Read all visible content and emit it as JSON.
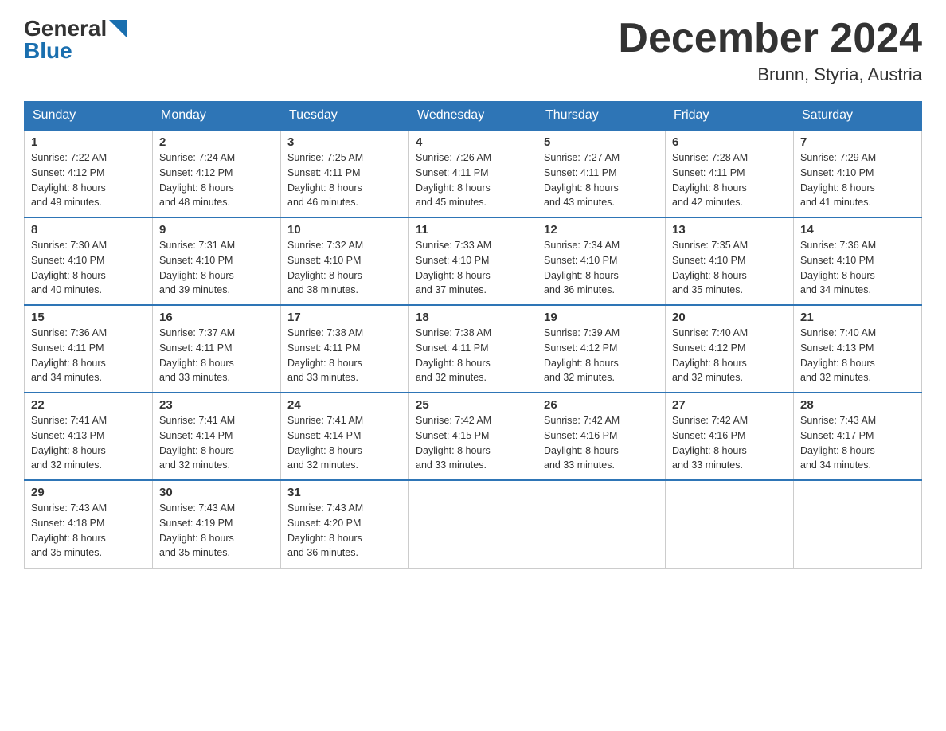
{
  "header": {
    "logo_general": "General",
    "logo_blue": "Blue",
    "title": "December 2024",
    "subtitle": "Brunn, Styria, Austria"
  },
  "days_of_week": [
    "Sunday",
    "Monday",
    "Tuesday",
    "Wednesday",
    "Thursday",
    "Friday",
    "Saturday"
  ],
  "weeks": [
    [
      {
        "day": "1",
        "sunrise": "7:22 AM",
        "sunset": "4:12 PM",
        "daylight": "8 hours and 49 minutes."
      },
      {
        "day": "2",
        "sunrise": "7:24 AM",
        "sunset": "4:12 PM",
        "daylight": "8 hours and 48 minutes."
      },
      {
        "day": "3",
        "sunrise": "7:25 AM",
        "sunset": "4:11 PM",
        "daylight": "8 hours and 46 minutes."
      },
      {
        "day": "4",
        "sunrise": "7:26 AM",
        "sunset": "4:11 PM",
        "daylight": "8 hours and 45 minutes."
      },
      {
        "day": "5",
        "sunrise": "7:27 AM",
        "sunset": "4:11 PM",
        "daylight": "8 hours and 43 minutes."
      },
      {
        "day": "6",
        "sunrise": "7:28 AM",
        "sunset": "4:11 PM",
        "daylight": "8 hours and 42 minutes."
      },
      {
        "day": "7",
        "sunrise": "7:29 AM",
        "sunset": "4:10 PM",
        "daylight": "8 hours and 41 minutes."
      }
    ],
    [
      {
        "day": "8",
        "sunrise": "7:30 AM",
        "sunset": "4:10 PM",
        "daylight": "8 hours and 40 minutes."
      },
      {
        "day": "9",
        "sunrise": "7:31 AM",
        "sunset": "4:10 PM",
        "daylight": "8 hours and 39 minutes."
      },
      {
        "day": "10",
        "sunrise": "7:32 AM",
        "sunset": "4:10 PM",
        "daylight": "8 hours and 38 minutes."
      },
      {
        "day": "11",
        "sunrise": "7:33 AM",
        "sunset": "4:10 PM",
        "daylight": "8 hours and 37 minutes."
      },
      {
        "day": "12",
        "sunrise": "7:34 AM",
        "sunset": "4:10 PM",
        "daylight": "8 hours and 36 minutes."
      },
      {
        "day": "13",
        "sunrise": "7:35 AM",
        "sunset": "4:10 PM",
        "daylight": "8 hours and 35 minutes."
      },
      {
        "day": "14",
        "sunrise": "7:36 AM",
        "sunset": "4:10 PM",
        "daylight": "8 hours and 34 minutes."
      }
    ],
    [
      {
        "day": "15",
        "sunrise": "7:36 AM",
        "sunset": "4:11 PM",
        "daylight": "8 hours and 34 minutes."
      },
      {
        "day": "16",
        "sunrise": "7:37 AM",
        "sunset": "4:11 PM",
        "daylight": "8 hours and 33 minutes."
      },
      {
        "day": "17",
        "sunrise": "7:38 AM",
        "sunset": "4:11 PM",
        "daylight": "8 hours and 33 minutes."
      },
      {
        "day": "18",
        "sunrise": "7:38 AM",
        "sunset": "4:11 PM",
        "daylight": "8 hours and 32 minutes."
      },
      {
        "day": "19",
        "sunrise": "7:39 AM",
        "sunset": "4:12 PM",
        "daylight": "8 hours and 32 minutes."
      },
      {
        "day": "20",
        "sunrise": "7:40 AM",
        "sunset": "4:12 PM",
        "daylight": "8 hours and 32 minutes."
      },
      {
        "day": "21",
        "sunrise": "7:40 AM",
        "sunset": "4:13 PM",
        "daylight": "8 hours and 32 minutes."
      }
    ],
    [
      {
        "day": "22",
        "sunrise": "7:41 AM",
        "sunset": "4:13 PM",
        "daylight": "8 hours and 32 minutes."
      },
      {
        "day": "23",
        "sunrise": "7:41 AM",
        "sunset": "4:14 PM",
        "daylight": "8 hours and 32 minutes."
      },
      {
        "day": "24",
        "sunrise": "7:41 AM",
        "sunset": "4:14 PM",
        "daylight": "8 hours and 32 minutes."
      },
      {
        "day": "25",
        "sunrise": "7:42 AM",
        "sunset": "4:15 PM",
        "daylight": "8 hours and 33 minutes."
      },
      {
        "day": "26",
        "sunrise": "7:42 AM",
        "sunset": "4:16 PM",
        "daylight": "8 hours and 33 minutes."
      },
      {
        "day": "27",
        "sunrise": "7:42 AM",
        "sunset": "4:16 PM",
        "daylight": "8 hours and 33 minutes."
      },
      {
        "day": "28",
        "sunrise": "7:43 AM",
        "sunset": "4:17 PM",
        "daylight": "8 hours and 34 minutes."
      }
    ],
    [
      {
        "day": "29",
        "sunrise": "7:43 AM",
        "sunset": "4:18 PM",
        "daylight": "8 hours and 35 minutes."
      },
      {
        "day": "30",
        "sunrise": "7:43 AM",
        "sunset": "4:19 PM",
        "daylight": "8 hours and 35 minutes."
      },
      {
        "day": "31",
        "sunrise": "7:43 AM",
        "sunset": "4:20 PM",
        "daylight": "8 hours and 36 minutes."
      },
      null,
      null,
      null,
      null
    ]
  ],
  "labels": {
    "sunrise": "Sunrise:",
    "sunset": "Sunset:",
    "daylight": "Daylight:"
  }
}
